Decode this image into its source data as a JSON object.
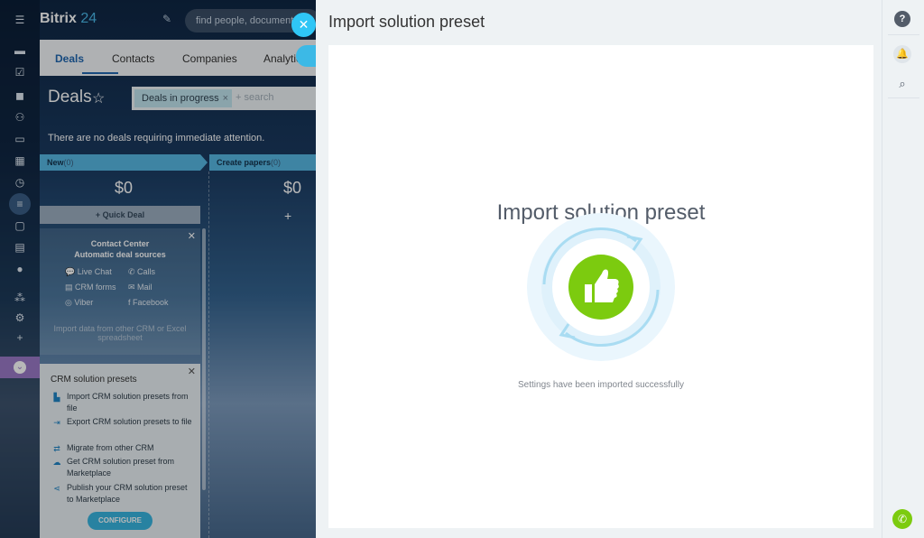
{
  "app": {
    "brand_name": "Bitrix",
    "brand_number": "24",
    "search_placeholder": "find people, documents, a"
  },
  "crm": {
    "tabs": [
      "Deals",
      "Contacts",
      "Companies",
      "Analytic"
    ],
    "page_title": "Deals",
    "filter_chip": "Deals in progress",
    "filter_search": "+ search",
    "notice": "There are no deals requiring immediate attention.",
    "stages": [
      {
        "name": "New",
        "count": "(0)",
        "sum": "$0"
      },
      {
        "name": "Create papers",
        "count": "(0)",
        "sum": "$0"
      }
    ],
    "quick_deal": "+ Quick Deal",
    "contact_center": {
      "title": "Contact Center",
      "subtitle": "Automatic deal sources",
      "items": [
        "Live Chat",
        "Calls",
        "CRM forms",
        "Mail",
        "Viber",
        "Facebook"
      ],
      "import_text": "Import data from other CRM or Excel spreadsheet"
    },
    "solutions": {
      "title": "CRM solution presets",
      "items": [
        "Import CRM solution presets from file",
        "Export CRM solution presets to file",
        "Migrate from other CRM",
        "Get CRM solution preset from Marketplace",
        "Publish your CRM solution preset to Marketplace"
      ],
      "configure": "CONFIGURE"
    }
  },
  "panel": {
    "title": "Import solution preset",
    "heading": "Import solution preset",
    "status": "Settings have been imported successfully"
  },
  "colors": {
    "accent": "#2fc6f6",
    "success": "#7ccb0f",
    "phone": "#7ccb0f"
  }
}
